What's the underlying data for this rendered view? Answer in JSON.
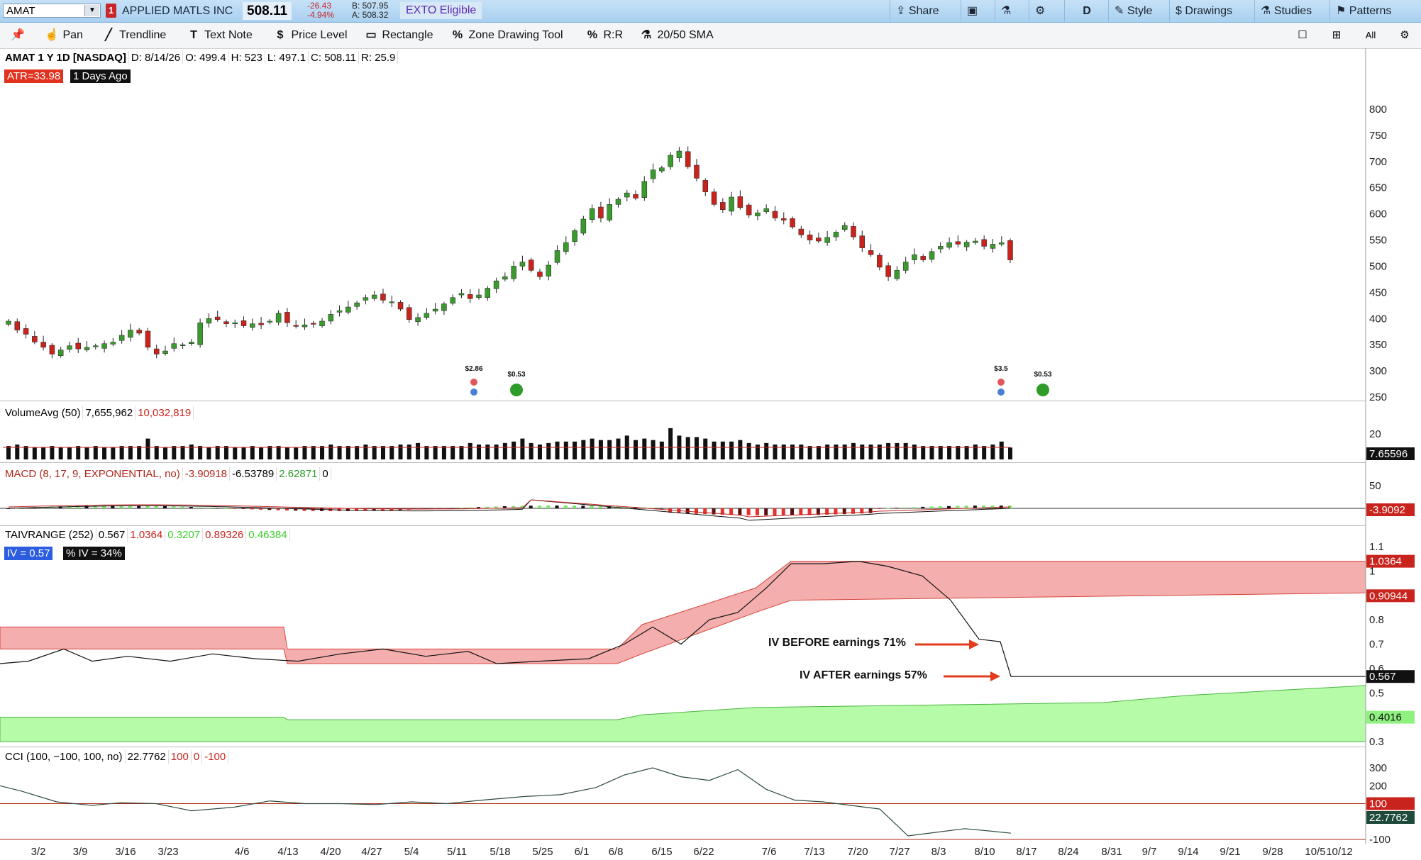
{
  "topbar": {
    "symbol": "AMAT",
    "alert_count": "1",
    "company": "APPLIED MATLS INC",
    "last": "508.11",
    "change": "-26.43",
    "change_pct": "-4.94%",
    "bid": "B: 507.95",
    "ask": "A: 508.32",
    "exto": "EXTO Eligible",
    "share": "Share",
    "period": "D",
    "style": "Style",
    "drawings": "Drawings",
    "studies": "Studies",
    "patterns": "Patterns"
  },
  "toolbar": {
    "pan": "Pan",
    "trendline": "Trendline",
    "text_note": "Text Note",
    "price_level": "Price Level",
    "rectangle": "Rectangle",
    "zone_tool": "Zone Drawing Tool",
    "rr": "R:R",
    "sma": "20/50 SMA",
    "all": "All"
  },
  "price_header": {
    "title": "AMAT 1 Y 1D [NASDAQ]",
    "date": "D: 8/14/26",
    "open": "O: 499.4",
    "high": "H: 523",
    "low": "L: 497.1",
    "close": "C: 508.11",
    "range": "R: 25.9",
    "atr": "ATR=33.98",
    "ago": "1 Days Ago"
  },
  "volume_header": {
    "name": "VolumeAvg (50)",
    "v1": "7,655,962",
    "v2": "10,032,819",
    "tag": "7.65596",
    "axis": "20"
  },
  "macd_header": {
    "name": "MACD (8, 17, 9, EXPONENTIAL, no)",
    "v1": "-3.90918",
    "v2": "-6.53789",
    "v3": "2.62871",
    "v4": "0",
    "tag": "-3.9092",
    "axis": "50"
  },
  "iv_header": {
    "name": "TAIVRANGE (252)",
    "v1": "0.567",
    "v2": "1.0364",
    "v3": "0.3207",
    "v4": "0.89326",
    "v5": "0.46384",
    "iv": "IV = 0.57",
    "pct_iv": "% IV = 34%",
    "tag_high": "1.0364",
    "tag_mid": "0.90944",
    "tag_iv": "0.567",
    "tag_low": "0.4016"
  },
  "cci_header": {
    "name": "CCI (100, −100, 100, no)",
    "v1": "22.7762",
    "v2": "100",
    "v3": "0",
    "v4": "-100",
    "tag_100": "100",
    "tag_val": "22.7762"
  },
  "annotations": {
    "before": "IV BEFORE earnings 71%",
    "after": "IV AFTER earnings 57%"
  },
  "earnings": [
    {
      "label": "$2.86"
    },
    {
      "label": "$0.53"
    },
    {
      "label": "$3.5"
    },
    {
      "label": "$0.53"
    }
  ],
  "colors": {
    "up": "#3a9a2e",
    "down": "#c8231c",
    "band_high": "#f4aeae",
    "band_low": "#b6fba8",
    "arrow": "#e23b1e"
  },
  "chart_data": {
    "type": "candlestick",
    "price_axis": {
      "ticks": [
        800,
        750,
        700,
        650,
        600,
        550,
        500,
        450,
        400,
        350,
        300,
        250
      ]
    },
    "iv_axis": {
      "ticks": [
        "1.1",
        "1",
        "0.8",
        "0.7",
        "0.6",
        "0.5",
        "0.3"
      ]
    },
    "cci_axis": {
      "ticks": [
        "300",
        "200",
        "100",
        "-100"
      ]
    },
    "dates": [
      "3/2",
      "3/9",
      "3/16",
      "3/23",
      "4/6",
      "4/13",
      "4/20",
      "4/27",
      "5/4",
      "5/11",
      "5/18",
      "5/25",
      "6/1",
      "6/8",
      "6/15",
      "6/22",
      "7/6",
      "7/13",
      "7/20",
      "7/27",
      "8/3",
      "8/10",
      "8/17",
      "8/24",
      "8/31",
      "9/7",
      "9/14",
      "9/21",
      "9/28",
      "10/5",
      "10/12"
    ],
    "price_series": {
      "name": "AMAT",
      "close": [
        395,
        378,
        370,
        355,
        345,
        332,
        340,
        348,
        342,
        345,
        348,
        352,
        355,
        368,
        378,
        372,
        345,
        332,
        338,
        352,
        350,
        355,
        392,
        400,
        398,
        390,
        392,
        386,
        390,
        388,
        395,
        410,
        392,
        385,
        388,
        390,
        395,
        408,
        415,
        422,
        430,
        440,
        445,
        435,
        432,
        418,
        398,
        402,
        410,
        418,
        428,
        440,
        448,
        438,
        445,
        458,
        472,
        480,
        500,
        508,
        492,
        480,
        502,
        530,
        545,
        568,
        590,
        610,
        592,
        618,
        628,
        640,
        630,
        662,
        684,
        688,
        712,
        720,
        690,
        668,
        642,
        618,
        608,
        632,
        612,
        598,
        602,
        610,
        592,
        588,
        575,
        560,
        550,
        548,
        555,
        565,
        578,
        556,
        535,
        522,
        498,
        480,
        492,
        508,
        522,
        512,
        528,
        538,
        545,
        542,
        546,
        548,
        538,
        542,
        545,
        512
      ],
      "volume": [
        9,
        10,
        9,
        8,
        8,
        9,
        8,
        8,
        9,
        8,
        9,
        8,
        8,
        9,
        9,
        9,
        14,
        9,
        8,
        9,
        9,
        10,
        9,
        8,
        9,
        9,
        8,
        8,
        9,
        8,
        9,
        9,
        8,
        8,
        9,
        9,
        9,
        10,
        9,
        9,
        9,
        10,
        9,
        9,
        9,
        10,
        10,
        11,
        9,
        9,
        9,
        9,
        9,
        11,
        10,
        10,
        10,
        11,
        12,
        14,
        11,
        10,
        11,
        12,
        12,
        12,
        13,
        14,
        13,
        13,
        14,
        16,
        13,
        14,
        13,
        12,
        21,
        16,
        15,
        15,
        14,
        12,
        12,
        12,
        13,
        11,
        10,
        11,
        10,
        10,
        10,
        10,
        9,
        9,
        10,
        10,
        10,
        11,
        10,
        10,
        10,
        11,
        11,
        11,
        10,
        9,
        9,
        9,
        9,
        9,
        9,
        10,
        9,
        10,
        12,
        8
      ]
    },
    "iv_series": {
      "name": "IV"
    },
    "cci_series": {
      "name": "CCI"
    }
  }
}
